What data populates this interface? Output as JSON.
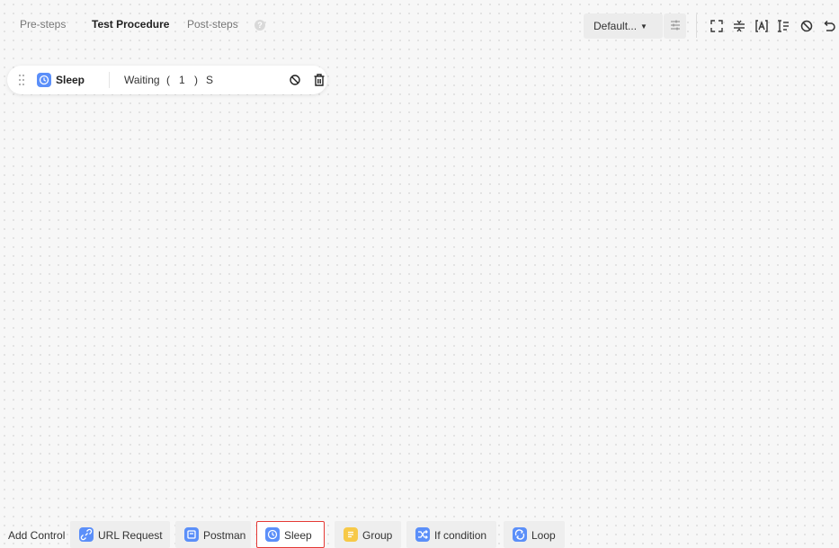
{
  "tabs": [
    {
      "label": "Pre-steps",
      "active": false
    },
    {
      "label": "Test Procedure",
      "active": true
    },
    {
      "label": "Post-steps",
      "active": false
    }
  ],
  "help_icon": "question-icon",
  "toolbar": {
    "select_value": "Default...",
    "icons": [
      "filter-icon",
      "expand-icon",
      "collapse-icon",
      "variable-icon",
      "sort-icon",
      "disable-icon",
      "undo-icon"
    ]
  },
  "step": {
    "name": "Sleep",
    "waiting_label": "Waiting",
    "open_paren": "(",
    "value": "1",
    "close_paren": ")",
    "unit": "S",
    "icons": [
      "drag-handle-icon",
      "clock-icon",
      "disable-icon",
      "trash-icon"
    ]
  },
  "add_control": {
    "label": "Add Control",
    "items": [
      {
        "label": "URL Request",
        "icon": "link-icon",
        "color": "#5b8ff9"
      },
      {
        "label": "Postman",
        "icon": "postman-icon",
        "color": "#5b8ff9"
      },
      {
        "label": "Sleep",
        "icon": "clock-icon",
        "color": "#5b8ff9",
        "selected": true
      },
      {
        "label": "Group",
        "icon": "group-icon",
        "color": "#f7c948"
      },
      {
        "label": "If condition",
        "icon": "shuffle-icon",
        "color": "#5b8ff9"
      },
      {
        "label": "Loop",
        "icon": "loop-icon",
        "color": "#5b8ff9"
      }
    ]
  },
  "colors": {
    "accent": "#5b8ff9",
    "selected_border": "#e53935",
    "group": "#f7c948"
  }
}
